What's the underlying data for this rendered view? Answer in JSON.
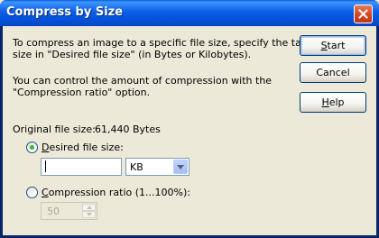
{
  "window": {
    "title": "Compress by Size"
  },
  "description": {
    "line1": "To compress an image to a specific file size, specify the target",
    "line2": "size in \"Desired file size\" (in Bytes or Kilobytes).",
    "line3": "You can control the amount of compression with the",
    "line4": "\"Compression ratio\" option."
  },
  "original": {
    "label": "Original file size:",
    "value": "61,440 Bytes"
  },
  "desired": {
    "label_prefix": "",
    "label_mnemonic": "D",
    "label_rest": "esired file size:",
    "checked": true,
    "input_value": "",
    "unit_selected": "KB"
  },
  "ratio": {
    "label_mnemonic": "C",
    "label_rest": "ompression ratio (1...100%):",
    "checked": false,
    "value": "50"
  },
  "buttons": {
    "start_mnemonic": "S",
    "start_rest": "tart",
    "cancel": "Cancel",
    "help_mnemonic": "H",
    "help_rest": "elp"
  },
  "icons": [
    "close-icon",
    "chevron-down-icon",
    "spin-up-icon",
    "spin-down-icon"
  ],
  "colors": {
    "titlebar": "#0553dc",
    "accent": "#21a121",
    "face": "#ece9d8"
  }
}
